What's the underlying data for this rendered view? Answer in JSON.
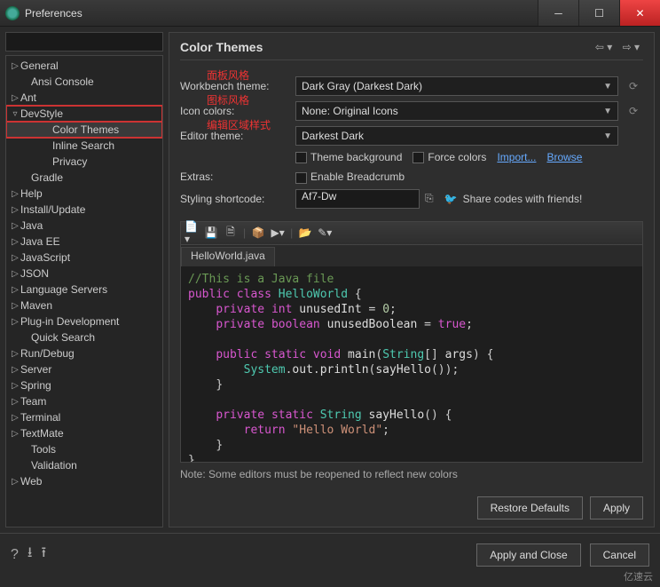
{
  "window": {
    "title": "Preferences"
  },
  "tree": {
    "items": [
      {
        "label": "General",
        "depth": 0,
        "exp": true
      },
      {
        "label": "Ansi Console",
        "depth": 1
      },
      {
        "label": "Ant",
        "depth": 0,
        "exp": true
      },
      {
        "label": "DevStyle",
        "depth": 0,
        "exp": false,
        "hlred": true,
        "expanded": true
      },
      {
        "label": "Color Themes",
        "depth": 2,
        "hlred": true,
        "sel": true
      },
      {
        "label": "Inline Search",
        "depth": 2
      },
      {
        "label": "Privacy",
        "depth": 2
      },
      {
        "label": "Gradle",
        "depth": 1
      },
      {
        "label": "Help",
        "depth": 0,
        "exp": true
      },
      {
        "label": "Install/Update",
        "depth": 0,
        "exp": true
      },
      {
        "label": "Java",
        "depth": 0,
        "exp": true
      },
      {
        "label": "Java EE",
        "depth": 0,
        "exp": true
      },
      {
        "label": "JavaScript",
        "depth": 0,
        "exp": true
      },
      {
        "label": "JSON",
        "depth": 0,
        "exp": true
      },
      {
        "label": "Language Servers",
        "depth": 0,
        "exp": true
      },
      {
        "label": "Maven",
        "depth": 0,
        "exp": true
      },
      {
        "label": "Plug-in Development",
        "depth": 0,
        "exp": true
      },
      {
        "label": "Quick Search",
        "depth": 1
      },
      {
        "label": "Run/Debug",
        "depth": 0,
        "exp": true
      },
      {
        "label": "Server",
        "depth": 0,
        "exp": true
      },
      {
        "label": "Spring",
        "depth": 0,
        "exp": true
      },
      {
        "label": "Team",
        "depth": 0,
        "exp": true
      },
      {
        "label": "Terminal",
        "depth": 0,
        "exp": true
      },
      {
        "label": "TextMate",
        "depth": 0,
        "exp": true
      },
      {
        "label": "Tools",
        "depth": 1
      },
      {
        "label": "Validation",
        "depth": 1
      },
      {
        "label": "Web",
        "depth": 0,
        "exp": true
      }
    ]
  },
  "page": {
    "title": "Color Themes",
    "annotations": {
      "panel": "面板风格",
      "icon": "图标风格",
      "editor": "编辑区域样式"
    },
    "labels": {
      "workbench": "Workbench theme:",
      "icon": "Icon colors:",
      "editor": "Editor theme:",
      "extras": "Extras:",
      "shortcode": "Styling shortcode:"
    },
    "values": {
      "workbench": "Dark Gray (Darkest Dark)",
      "icon": "None: Original Icons",
      "editor": "Darkest Dark",
      "shortcode": "Af7-Dw"
    },
    "checks": {
      "themebg": "Theme background",
      "forcecolors": "Force colors",
      "breadcrumb": "Enable Breadcrumb"
    },
    "links": {
      "import": "Import...",
      "browse": "Browse"
    },
    "share": "Share codes with friends!",
    "tab": "HelloWorld.java",
    "note": "Note: Some editors must be reopened to reflect new colors",
    "code": {
      "comment": "//This is a Java file",
      "l2a": "public",
      "l2b": "class",
      "l2c": "HelloWorld",
      "l3a": "private",
      "l3b": "int",
      "l3c": "unusedInt",
      "l3d": "0",
      "l4a": "private",
      "l4b": "boolean",
      "l4c": "unusedBoolean",
      "l4d": "true",
      "l5a": "public",
      "l5b": "static",
      "l5c": "void",
      "l5d": "main",
      "l5e": "String",
      "l5f": "args",
      "l6a": "System",
      "l6b": "out",
      "l6c": "println",
      "l6d": "sayHello",
      "l8a": "private",
      "l8b": "static",
      "l8c": "String",
      "l8d": "sayHello",
      "l9a": "return",
      "l9b": "\"Hello World\""
    }
  },
  "buttons": {
    "restore": "Restore Defaults",
    "apply": "Apply",
    "applyclose": "Apply and Close",
    "cancel": "Cancel"
  },
  "watermark": "亿速云"
}
